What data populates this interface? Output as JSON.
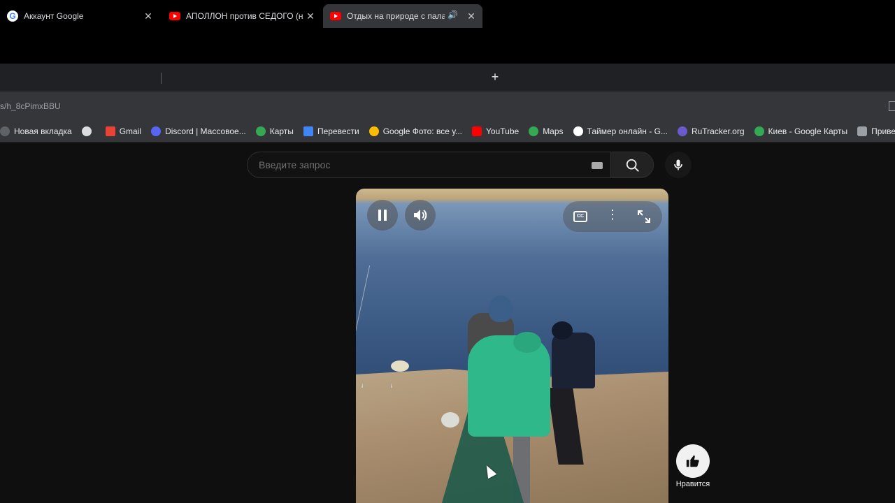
{
  "tabs": [
    {
      "title": "Аккаунт Google",
      "favicon": "google-icon",
      "active": false
    },
    {
      "title": "АПОЛЛОН против СЕДОГО (н",
      "favicon": "youtube-icon",
      "active": false
    },
    {
      "title": "Отдых на природе с пала",
      "favicon": "youtube-icon",
      "active": true,
      "audio": true
    }
  ],
  "address": {
    "url": "s/h_8cPimxBBU"
  },
  "bookmarks": [
    {
      "label": "Новая вкладка",
      "icon": "newtab-icon",
      "color": "#5f6368"
    },
    {
      "label": "",
      "icon": "globe-icon",
      "color": "#dadce0"
    },
    {
      "label": "Gmail",
      "icon": "gmail-icon",
      "color": "#ea4335"
    },
    {
      "label": "Discord | Массовое...",
      "icon": "discord-icon",
      "color": "#5865f2"
    },
    {
      "label": "Карты",
      "icon": "maps-icon",
      "color": "#34a853"
    },
    {
      "label": "Перевести",
      "icon": "translate-icon",
      "color": "#4285f4"
    },
    {
      "label": "Google Фото: все у...",
      "icon": "photos-icon",
      "color": "#fbbc04"
    },
    {
      "label": "YouTube",
      "icon": "youtube-icon",
      "color": "#ff0000"
    },
    {
      "label": "Maps",
      "icon": "maps-icon",
      "color": "#34a853"
    },
    {
      "label": "Таймер онлайн - G...",
      "icon": "timer-icon",
      "color": "#ffffff"
    },
    {
      "label": "RuTracker.org",
      "icon": "rutracker-icon",
      "color": "#6a5acd"
    },
    {
      "label": "Киев - Google Карты",
      "icon": "maps-icon",
      "color": "#34a853"
    },
    {
      "label": "Привет",
      "icon": "site-icon",
      "color": "#9aa0a6"
    }
  ],
  "search": {
    "placeholder": "Введите запрос"
  },
  "player": {
    "like_label": "Нравится",
    "cc_label": "CC"
  }
}
